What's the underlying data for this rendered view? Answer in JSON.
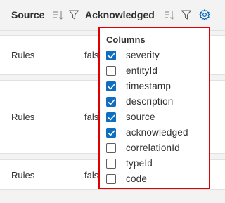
{
  "header": {
    "columns": [
      {
        "label": "Source"
      },
      {
        "label": "Acknowledged"
      }
    ]
  },
  "rows": [
    {
      "source": "Rules",
      "acknowledged": "false"
    },
    {
      "source": "Rules",
      "acknowledged": "false"
    },
    {
      "source": "Rules",
      "acknowledged": "false"
    }
  ],
  "columns_popup": {
    "title": "Columns",
    "options": [
      {
        "label": "severity",
        "checked": true
      },
      {
        "label": "entityId",
        "checked": false
      },
      {
        "label": "timestamp",
        "checked": true
      },
      {
        "label": "description",
        "checked": true
      },
      {
        "label": "source",
        "checked": true
      },
      {
        "label": "acknowledged",
        "checked": true
      },
      {
        "label": "correlationId",
        "checked": false
      },
      {
        "label": "typeId",
        "checked": false
      },
      {
        "label": "code",
        "checked": false
      }
    ]
  },
  "colors": {
    "checkbox_checked": "#106ebe",
    "popup_border": "#e00000",
    "settings_icon": "#0f6cbd"
  },
  "icons": [
    "sort-icon",
    "filter-icon",
    "settings-gear-icon",
    "checkmark-icon"
  ]
}
